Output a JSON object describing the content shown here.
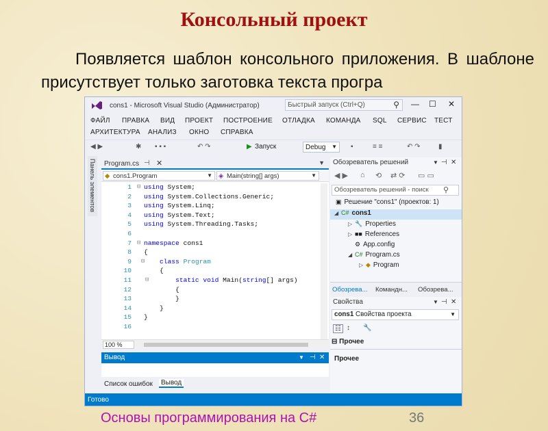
{
  "slide": {
    "title": "Консольный проект",
    "paragraph": "Появляется шаблон консольного приложения. В шаблоне присутствует только заготовка текста програ",
    "footer": "Основы программирования на C#",
    "page_number": "36"
  },
  "window": {
    "title": "cons1 - Microsoft Visual Studio (Администратор)",
    "quick_launch": "Быстрый запуск (Ctrl+Q)"
  },
  "menu_row1": [
    "ФАЙЛ",
    "ПРАВКА",
    "ВИД",
    "ПРОЕКТ",
    "ПОСТРОЕНИЕ",
    "ОТЛАДКА",
    "КОМАНДА",
    "SQL",
    "СЕРВИС",
    "ТЕСТ"
  ],
  "menu_row2": [
    "АРХИТЕКТУРА",
    "АНАЛИЗ",
    "ОКНО",
    "СПРАВКА"
  ],
  "toolbar": {
    "start": "Запуск",
    "config": "Debug"
  },
  "sidebar_label": "Панель элементов",
  "editor": {
    "tab": "Program.cs",
    "nav_left": "cons1.Program",
    "nav_right": "Main(string[] args)",
    "zoom": "100 %",
    "line_numbers": [
      "1",
      "2",
      "3",
      "4",
      "5",
      "6",
      "7",
      "8",
      "9",
      "10",
      "11",
      "12",
      "13",
      "14",
      "15",
      "16"
    ]
  },
  "output": {
    "title": "Вывод",
    "tab_errors": "Список ошибок",
    "tab_output": "Вывод"
  },
  "solution": {
    "title": "Обозреватель решений",
    "search": "Обозреватель решений - поиск",
    "tree": [
      "Решение \"cons1\" (проектов: 1)",
      "cons1",
      "Properties",
      "References",
      "App.config",
      "Program.cs",
      "Program"
    ],
    "tabs": [
      "Обозрева...",
      "Командн...",
      "Обозрева..."
    ]
  },
  "properties": {
    "title": "Свойства",
    "object_name": "cons1",
    "object_desc": "Свойства проекта",
    "category": "Прочее",
    "desc_title": "Прочее"
  },
  "status": "Готово"
}
